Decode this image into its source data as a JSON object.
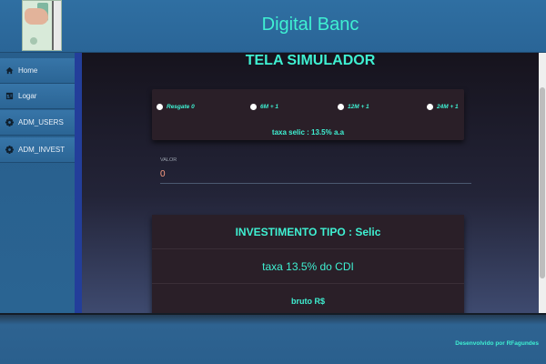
{
  "header": {
    "title": "Digital Banc"
  },
  "sidebar": {
    "items": [
      {
        "label": "Home",
        "icon": "home-icon"
      },
      {
        "label": "Logar",
        "icon": "id-card-icon"
      },
      {
        "label": "ADM_USERS",
        "icon": "gear-icon"
      },
      {
        "label": "ADM_INVEST",
        "icon": "gear-icon"
      }
    ]
  },
  "main": {
    "title": "TELA SIMULADOR",
    "period_options": [
      "Resgate 0",
      "6M + 1",
      "12M + 1",
      "24M + 1"
    ],
    "rate_text": "taxa selic : 13.5% a.a",
    "valor": {
      "label": "VALOR",
      "value": "0"
    },
    "result": {
      "type_text": "INVESTIMENTO TIPO : Selic",
      "rate_text": "taxa 13.5% do CDI",
      "gross_text": "bruto R$"
    }
  },
  "footer": {
    "credit": "Desenvolvido por RFagundes"
  },
  "colors": {
    "accent": "#3ff0d2",
    "header_bg": "#2f6fa2",
    "card_bg": "#2a1f28",
    "value_text": "#ff9e83"
  }
}
